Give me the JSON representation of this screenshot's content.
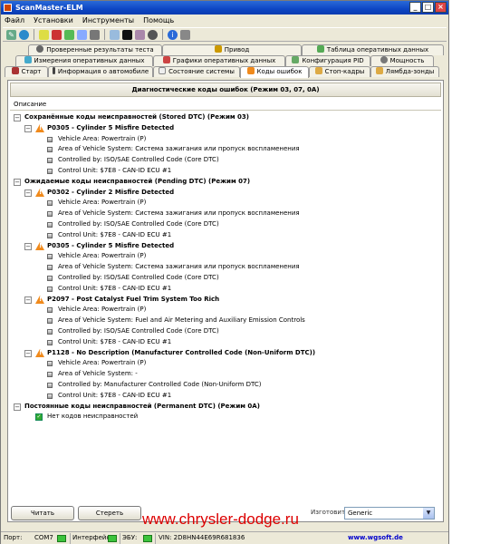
{
  "window": {
    "title": "ScanMaster-ELM",
    "controls": [
      "_",
      "□",
      "×"
    ]
  },
  "menu": {
    "items": [
      "Файл",
      "Установки",
      "Инструменты",
      "Помощь"
    ]
  },
  "toolbar": {
    "icons": [
      "wrench-icon",
      "globe-icon",
      "connect-icon",
      "graph-icon",
      "tiles-icon",
      "image-icon",
      "calc-icon",
      "monitor-icon",
      "terminal-icon",
      "car-icon",
      "disk-icon",
      "info-icon",
      "exit-icon"
    ]
  },
  "tabs": {
    "row1": [
      "Проверенные результаты теста",
      "Привод",
      "Таблица оперативных данных"
    ],
    "row2": [
      "Измерения оперативных данных",
      "Графики оперативных данных",
      "Конфигурация PID",
      "Мощность"
    ],
    "row3": [
      "Старт",
      "Информация о автомобиле",
      "Состояние системы",
      "Коды ошибок",
      "Стоп-кадры",
      "Лямбда-зонды"
    ],
    "active": "Коды ошибок"
  },
  "panel": {
    "title": "Диагностические коды ошибок (Режим 03, 07, 0A)",
    "column": "Описание"
  },
  "tree": {
    "stored": {
      "header": "Сохранённые коды неисправностей (Stored DTC) (Режим 03)",
      "codes": [
        {
          "title": "P0305 - Cylinder 5 Misfire Detected",
          "details": [
            "Vehicle Area: Powertrain (P)",
            "Area of Vehicle System: Система зажигания или пропуск воспламенения",
            "Controlled by: ISO/SAE Controlled Code (Core DTC)",
            "Control Unit: $7E8 - CAN-ID ECU #1"
          ]
        }
      ]
    },
    "pending": {
      "header": "Ожидаемые коды неисправностей (Pending DTC) (Режим 07)",
      "codes": [
        {
          "title": "P0302 - Cylinder 2 Misfire Detected",
          "details": [
            "Vehicle Area: Powertrain (P)",
            "Area of Vehicle System: Система зажигания или пропуск воспламенения",
            "Controlled by: ISO/SAE Controlled Code (Core DTC)",
            "Control Unit: $7E8 - CAN-ID ECU #1"
          ]
        },
        {
          "title": "P0305 - Cylinder 5 Misfire Detected",
          "details": [
            "Vehicle Area: Powertrain (P)",
            "Area of Vehicle System: Система зажигания или пропуск воспламенения",
            "Controlled by: ISO/SAE Controlled Code (Core DTC)",
            "Control Unit: $7E8 - CAN-ID ECU #1"
          ]
        },
        {
          "title": "P2097 - Post Catalyst Fuel Trim System Too Rich",
          "details": [
            "Vehicle Area: Powertrain (P)",
            "Area of Vehicle System: Fuel and Air Metering and Auxiliary Emission Controls",
            "Controlled by: ISO/SAE Controlled Code (Core DTC)",
            "Control Unit: $7E8 - CAN-ID ECU #1"
          ]
        },
        {
          "title": "P1128 - No Description (Manufacturer Controlled Code (Non-Uniform DTC))",
          "details": [
            "Vehicle Area: Powertrain (P)",
            "Area of Vehicle System: -",
            "Controlled by: Manufacturer Controlled Code (Non-Uniform DTC)",
            "Control Unit: $7E8 - CAN-ID ECU #1"
          ]
        }
      ]
    },
    "permanent": {
      "header": "Постоянные коды неисправностей (Permanent DTC) (Режим 0A)",
      "none_label": "Нет кодов неисправностей"
    }
  },
  "buttons": {
    "read": "Читать",
    "clear": "Стереть"
  },
  "manufacturer": {
    "label": "Изготовитель",
    "value": "Generic"
  },
  "status": {
    "port_label": "Порт:",
    "port": "COM7",
    "interface_label": "Интерфейс",
    "ecu_label": "ЭБУ:",
    "vin": "VIN: 2D8HN44E69R681836",
    "website": "www.wgsoft.de"
  },
  "watermark": "www.chrysler-dodge.ru"
}
